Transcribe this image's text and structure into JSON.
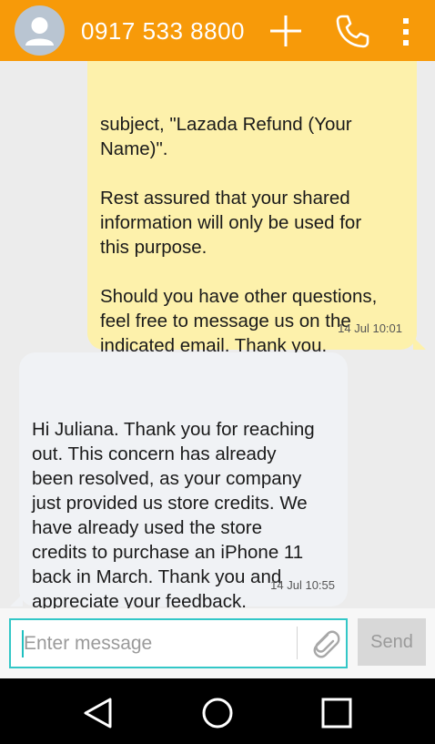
{
  "header": {
    "title": "0917 533 8800",
    "icons": {
      "avatar": "contact-avatar-icon",
      "add": "plus-icon",
      "call": "phone-icon",
      "menu": "more-vert-icon"
    },
    "color": "#f79a09"
  },
  "messages": [
    {
      "direction": "outgoing",
      "text": "subject, \"Lazada Refund (Your\nName)\".\n\nRest assured that your shared\ninformation will only be used for\nthis purpose.\n\nShould you have other questions,\nfeel free to message us on the\nindicated email. Thank you.",
      "time": "14 Jul 10:01",
      "color": "#fdf1ab"
    },
    {
      "direction": "incoming",
      "text": "Hi Juliana. Thank you for reaching\nout. This concern has already\nbeen resolved, as your company\njust provided us store credits. We\nhave already used the store\ncredits to purchase an iPhone 11\nback in March. Thank you and\nappreciate your feedback.",
      "time": "14 Jul 10:55",
      "color": "#f0f2f5"
    }
  ],
  "composer": {
    "placeholder": "Enter message",
    "value": "",
    "attach_icon": "paperclip-icon",
    "send_label": "Send",
    "accent": "#33c7c7"
  },
  "navbar": {
    "back_icon": "triangle-back-icon",
    "home_icon": "circle-home-icon",
    "recents_icon": "square-recents-icon"
  }
}
